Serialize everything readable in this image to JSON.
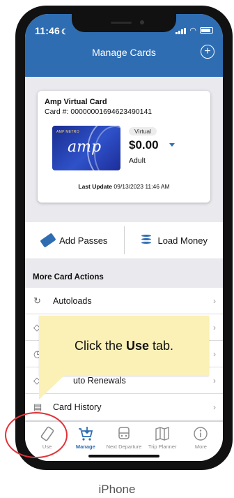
{
  "status_bar": {
    "time": "11:46"
  },
  "header": {
    "title": "Manage Cards"
  },
  "card": {
    "name": "Amp Virtual Card",
    "number": "Card #: 00000001694623490141",
    "image_brand_small": "AMP METRO",
    "image_brand": "amp",
    "status_pill": "Virtual",
    "balance": "$0.00",
    "fare_type": "Adult",
    "last_update_label": "Last Update",
    "last_update_value": "09/13/2023 11:46 AM"
  },
  "actions": [
    {
      "label": "Add Passes",
      "icon": "ticket-icon"
    },
    {
      "label": "Load Money",
      "icon": "coins-icon"
    }
  ],
  "more_actions": {
    "heading": "More Card Actions",
    "items": [
      {
        "label": "Autoloads",
        "icon": "refresh-icon"
      },
      {
        "label": "",
        "icon": "tag-icon"
      },
      {
        "label": "",
        "icon": "clock-icon"
      },
      {
        "label": "P      uto Renewals",
        "icon": "tag-icon"
      },
      {
        "label": "Card History",
        "icon": "document-icon"
      }
    ]
  },
  "tooltip": {
    "before": "Click the",
    "bold": "Use",
    "after": "tab."
  },
  "tabs": [
    {
      "label": "Use",
      "icon": "ticket-icon",
      "active": false
    },
    {
      "label": "Manage",
      "icon": "cart-icon",
      "active": true
    },
    {
      "label": "Next Departure",
      "icon": "bus-icon",
      "active": false
    },
    {
      "label": "Trip Planner",
      "icon": "map-icon",
      "active": false
    },
    {
      "label": "More",
      "icon": "info-icon",
      "active": false
    }
  ],
  "caption": "iPhone",
  "colors": {
    "primary": "#2f6db2",
    "tooltip": "#fbf0b6",
    "highlight": "#e0333a"
  }
}
